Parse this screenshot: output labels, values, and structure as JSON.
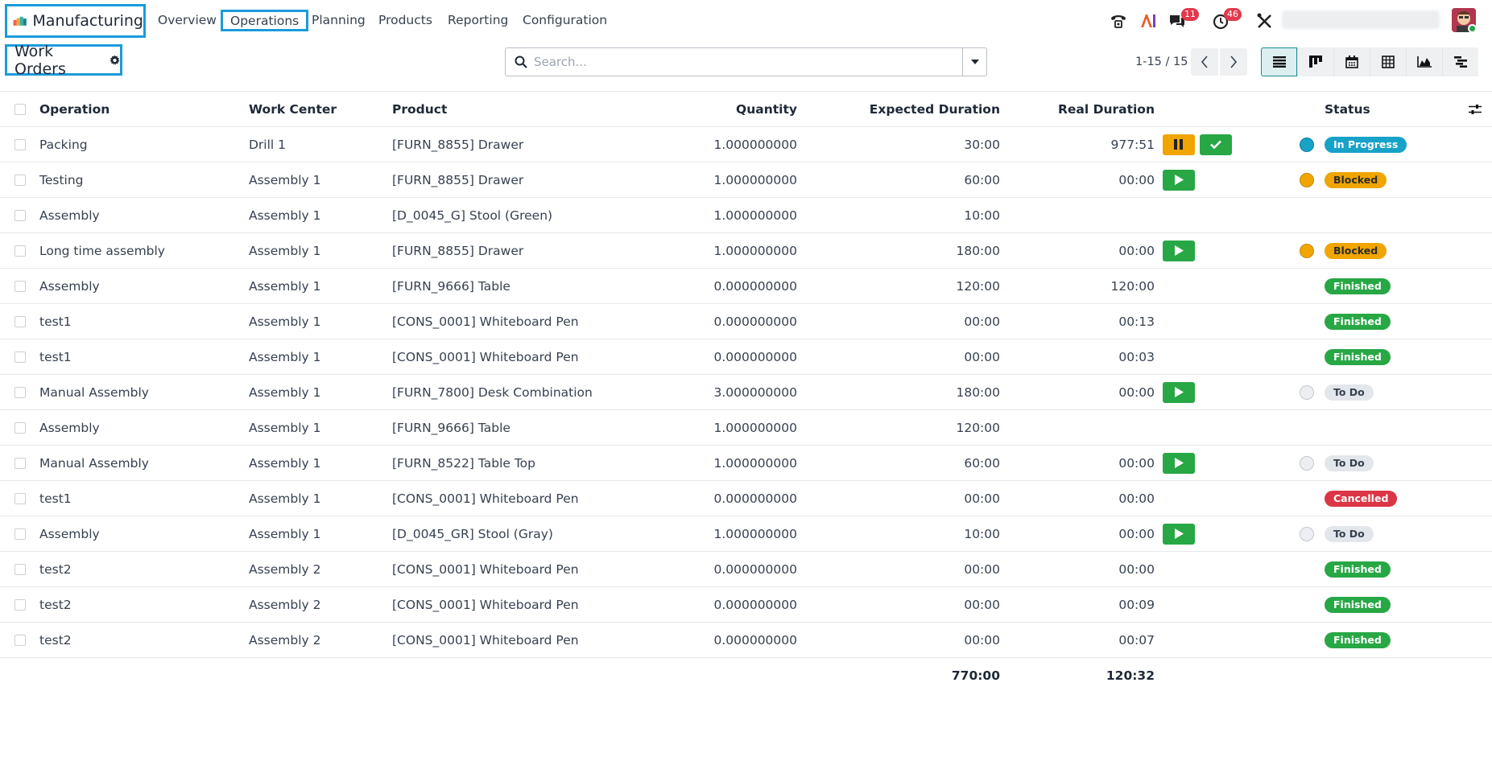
{
  "app": {
    "name": "Manufacturing"
  },
  "menu": [
    "Overview",
    "Operations",
    "Planning",
    "Products",
    "Reporting",
    "Configuration"
  ],
  "systray": {
    "messages_count": "11",
    "activities_count": "46"
  },
  "page": {
    "title": "Work Orders"
  },
  "search": {
    "placeholder": "Search..."
  },
  "pager": {
    "value": "1-15 / 15"
  },
  "columns": {
    "operation": "Operation",
    "work_center": "Work Center",
    "product": "Product",
    "quantity": "Quantity",
    "expected": "Expected Duration",
    "real": "Real Duration",
    "status": "Status"
  },
  "rows": [
    {
      "operation": "Packing",
      "work_center": "Drill 1",
      "product": "[FURN_8855] Drawer",
      "quantity": "1.000000000",
      "expected": "30:00",
      "real": "977:51",
      "buttons": "pause-done",
      "dot": "blue",
      "status": "In Progress",
      "status_kind": "progress"
    },
    {
      "operation": "Testing",
      "work_center": "Assembly 1",
      "product": "[FURN_8855] Drawer",
      "quantity": "1.000000000",
      "expected": "60:00",
      "real": "00:00",
      "buttons": "play",
      "dot": "orange",
      "status": "Blocked",
      "status_kind": "blocked"
    },
    {
      "operation": "Assembly",
      "work_center": "Assembly 1",
      "product": "[D_0045_G] Stool (Green)",
      "quantity": "1.000000000",
      "expected": "10:00",
      "real": "",
      "buttons": "",
      "dot": "",
      "status": "",
      "status_kind": ""
    },
    {
      "operation": "Long time assembly",
      "work_center": "Assembly 1",
      "product": "[FURN_8855] Drawer",
      "quantity": "1.000000000",
      "expected": "180:00",
      "real": "00:00",
      "buttons": "play",
      "dot": "orange",
      "status": "Blocked",
      "status_kind": "blocked"
    },
    {
      "operation": "Assembly",
      "work_center": "Assembly 1",
      "product": "[FURN_9666] Table",
      "quantity": "0.000000000",
      "expected": "120:00",
      "real": "120:00",
      "buttons": "",
      "dot": "",
      "status": "Finished",
      "status_kind": "finished"
    },
    {
      "operation": "test1",
      "work_center": "Assembly 1",
      "product": "[CONS_0001] Whiteboard Pen",
      "quantity": "0.000000000",
      "expected": "00:00",
      "real": "00:13",
      "buttons": "",
      "dot": "",
      "status": "Finished",
      "status_kind": "finished"
    },
    {
      "operation": "test1",
      "work_center": "Assembly 1",
      "product": "[CONS_0001] Whiteboard Pen",
      "quantity": "0.000000000",
      "expected": "00:00",
      "real": "00:03",
      "buttons": "",
      "dot": "",
      "status": "Finished",
      "status_kind": "finished"
    },
    {
      "operation": "Manual Assembly",
      "work_center": "Assembly 1",
      "product": "[FURN_7800] Desk Combination",
      "quantity": "3.000000000",
      "expected": "180:00",
      "real": "00:00",
      "buttons": "play",
      "dot": "grey",
      "status": "To Do",
      "status_kind": "todo"
    },
    {
      "operation": "Assembly",
      "work_center": "Assembly 1",
      "product": "[FURN_9666] Table",
      "quantity": "1.000000000",
      "expected": "120:00",
      "real": "",
      "buttons": "",
      "dot": "",
      "status": "",
      "status_kind": ""
    },
    {
      "operation": "Manual Assembly",
      "work_center": "Assembly 1",
      "product": "[FURN_8522] Table Top",
      "quantity": "1.000000000",
      "expected": "60:00",
      "real": "00:00",
      "buttons": "play",
      "dot": "grey",
      "status": "To Do",
      "status_kind": "todo"
    },
    {
      "operation": "test1",
      "work_center": "Assembly 1",
      "product": "[CONS_0001] Whiteboard Pen",
      "quantity": "0.000000000",
      "expected": "00:00",
      "real": "00:00",
      "buttons": "",
      "dot": "",
      "status": "Cancelled",
      "status_kind": "cancelled"
    },
    {
      "operation": "Assembly",
      "work_center": "Assembly 1",
      "product": "[D_0045_GR] Stool (Gray)",
      "quantity": "1.000000000",
      "expected": "10:00",
      "real": "00:00",
      "buttons": "play",
      "dot": "grey",
      "status": "To Do",
      "status_kind": "todo"
    },
    {
      "operation": "test2",
      "work_center": "Assembly 2",
      "product": "[CONS_0001] Whiteboard Pen",
      "quantity": "0.000000000",
      "expected": "00:00",
      "real": "00:00",
      "buttons": "",
      "dot": "",
      "status": "Finished",
      "status_kind": "finished"
    },
    {
      "operation": "test2",
      "work_center": "Assembly 2",
      "product": "[CONS_0001] Whiteboard Pen",
      "quantity": "0.000000000",
      "expected": "00:00",
      "real": "00:09",
      "buttons": "",
      "dot": "",
      "status": "Finished",
      "status_kind": "finished"
    },
    {
      "operation": "test2",
      "work_center": "Assembly 2",
      "product": "[CONS_0001] Whiteboard Pen",
      "quantity": "0.000000000",
      "expected": "00:00",
      "real": "00:07",
      "buttons": "",
      "dot": "",
      "status": "Finished",
      "status_kind": "finished"
    }
  ],
  "totals": {
    "expected": "770:00",
    "real": "120:32"
  },
  "colors": {
    "highlight": "#1a9bdc",
    "play": "#28a745",
    "pause": "#f0a500",
    "in_progress": "#17a2c8",
    "cancelled": "#dc3545"
  }
}
